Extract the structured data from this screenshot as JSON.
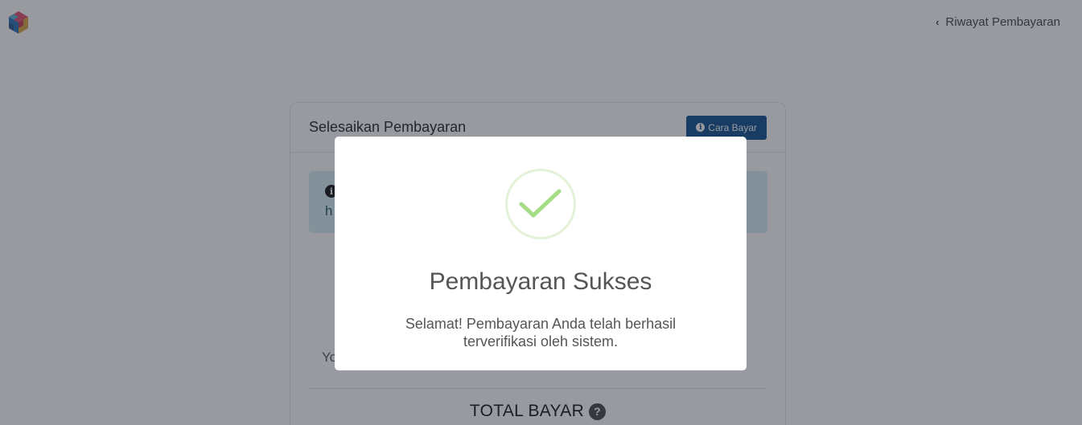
{
  "header": {
    "logo_icon": "multicolor-cube-logo",
    "history_link": "Riwayat Pembayaran"
  },
  "card": {
    "title": "Selesaikan Pembayaran",
    "howto_button": "Cara Bayar",
    "info_partial_text": "h",
    "partial_text": "Yo",
    "total_label": "TOTAL BAYAR",
    "total_help_icon": "question-circle-icon"
  },
  "modal": {
    "icon": "check-circle-icon",
    "accent_color": "#a5dc86",
    "title": "Pembayaran Sukses",
    "message": "Selamat! Pembayaran Anda telah berhasil terverifikasi oleh sistem."
  }
}
